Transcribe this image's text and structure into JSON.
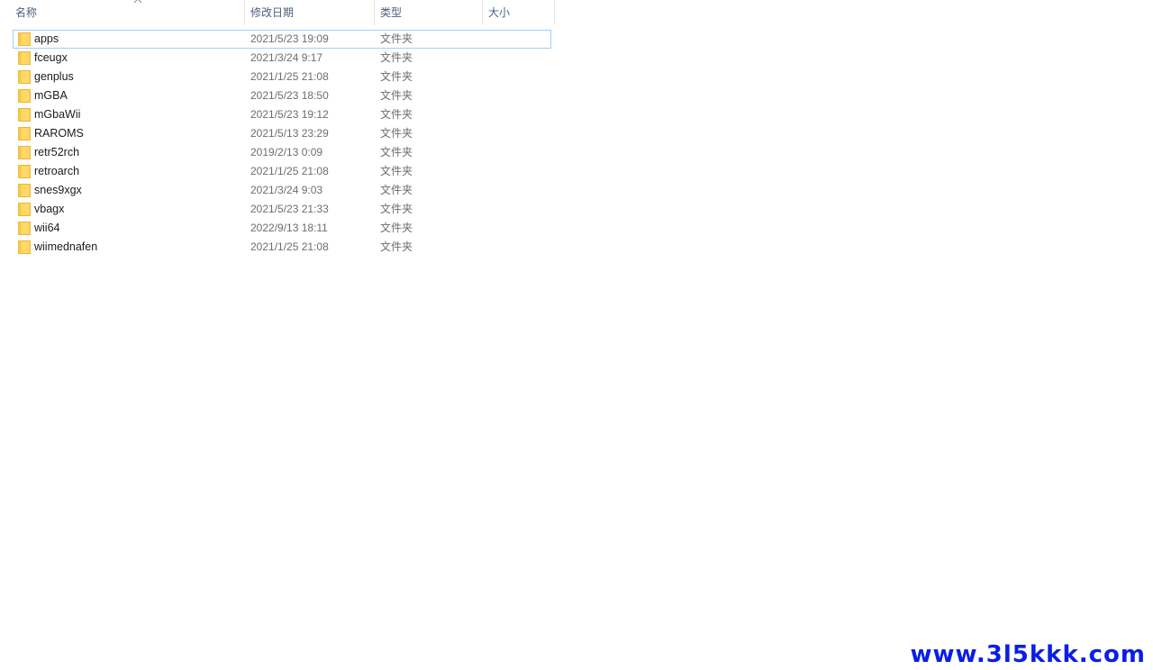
{
  "header": {
    "name_label": "名称",
    "date_label": "修改日期",
    "type_label": "类型",
    "size_label": "大小",
    "sort_icon": "chevron-up-icon"
  },
  "files": [
    {
      "name": "apps",
      "date": "2021/5/23 19:09",
      "type": "文件夹"
    },
    {
      "name": "fceugx",
      "date": "2021/3/24 9:17",
      "type": "文件夹"
    },
    {
      "name": "genplus",
      "date": "2021/1/25 21:08",
      "type": "文件夹"
    },
    {
      "name": "mGBA",
      "date": "2021/5/23 18:50",
      "type": "文件夹"
    },
    {
      "name": "mGbaWii",
      "date": "2021/5/23 19:12",
      "type": "文件夹"
    },
    {
      "name": "RAROMS",
      "date": "2021/5/13 23:29",
      "type": "文件夹"
    },
    {
      "name": "retr52rch",
      "date": "2019/2/13 0:09",
      "type": "文件夹"
    },
    {
      "name": "retroarch",
      "date": "2021/1/25 21:08",
      "type": "文件夹"
    },
    {
      "name": "snes9xgx",
      "date": "2021/3/24 9:03",
      "type": "文件夹"
    },
    {
      "name": "vbagx",
      "date": "2021/5/23 21:33",
      "type": "文件夹"
    },
    {
      "name": "wii64",
      "date": "2022/9/13 18:11",
      "type": "文件夹"
    },
    {
      "name": "wiimednafen",
      "date": "2021/1/25 21:08",
      "type": "文件夹"
    }
  ],
  "watermark": "www.3l5kkk.com",
  "colors": {
    "folder_fill": "#ffd866",
    "folder_edge": "#e8b537",
    "selection_border": "#99d1ff",
    "header_text": "#4c607a",
    "watermark": "#0b1ee8"
  }
}
